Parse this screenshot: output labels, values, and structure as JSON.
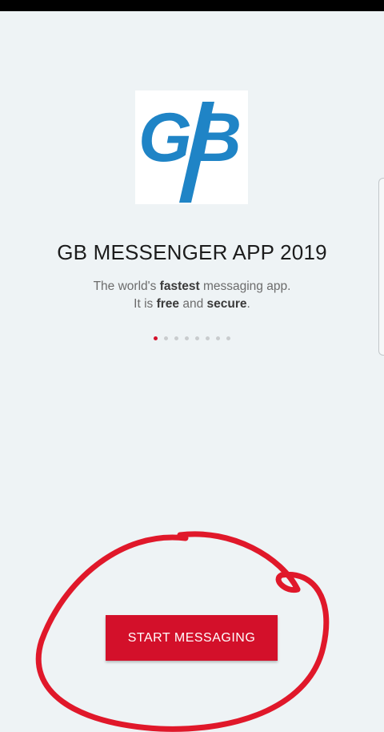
{
  "logo": {
    "text": "GB",
    "icon": "gb-logo-icon",
    "color": "#1f84c6"
  },
  "onboarding": {
    "title": "GB MESSENGER APP 2019",
    "tagline_line1_prefix": "The world's ",
    "tagline_line1_bold": "fastest",
    "tagline_line1_suffix": " messaging app.",
    "tagline_line2_prefix": "It is ",
    "tagline_line2_bold1": "free",
    "tagline_line2_mid": " and ",
    "tagline_line2_bold2": "secure",
    "tagline_line2_suffix": "."
  },
  "pager": {
    "page_count": 8,
    "active_index": 0,
    "active_color": "#d3102a"
  },
  "start_button": {
    "label": "START MESSAGING",
    "color": "#d3102a"
  },
  "annotation": {
    "shape": "hand-drawn-circle",
    "color": "#e0182a"
  }
}
